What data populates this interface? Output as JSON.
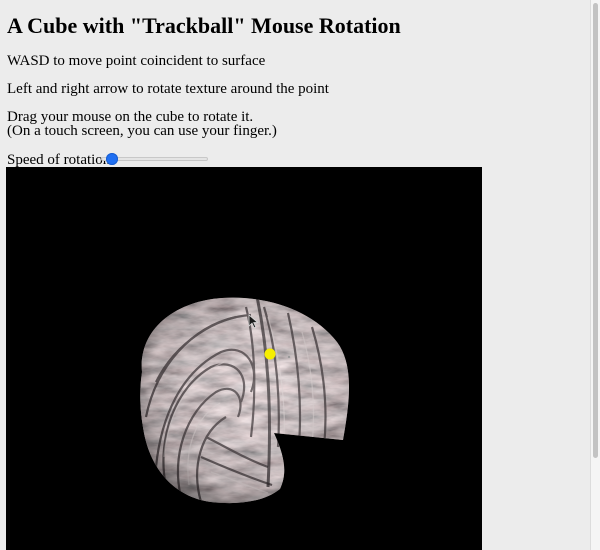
{
  "page": {
    "title": "A Cube with \"Trackball\" Mouse Rotation",
    "instructions": {
      "wasd": "WASD to move point coincident to surface",
      "arrows": "Left and right arrow to rotate texture around the point",
      "drag_line1": "Drag your mouse on the cube to rotate it.",
      "drag_line2": "(On a touch screen, you can use your finger.)"
    }
  },
  "controls": {
    "speed_label": "Speed of rotation",
    "speed_value": 0.05
  },
  "canvas": {
    "background": "#000000",
    "surface_colors": [
      "#6f6567",
      "#8b7f80",
      "#b3a6a6",
      "#4a4244",
      "#d6cbcb"
    ],
    "point_marker_color": "#f6ee00",
    "cursor_icon": "arrow-pointer-icon"
  },
  "colors": {
    "page_background": "#ececec",
    "slider_accent": "#1f6ff2"
  }
}
